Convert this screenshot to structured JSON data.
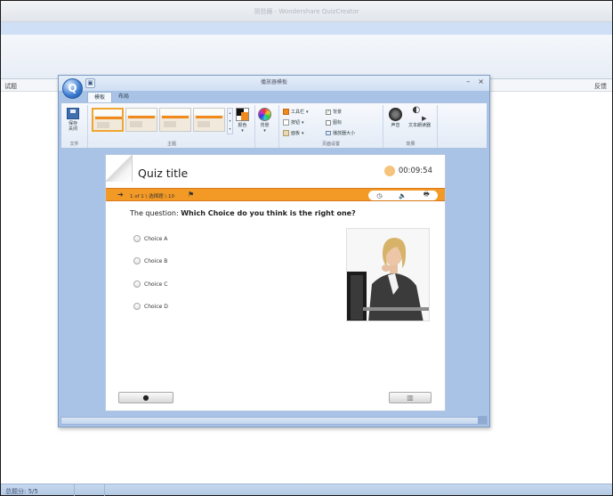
{
  "app": {
    "title": "测验器 - Wondershare QuizCreator",
    "left_panel_label": "试题",
    "right_panel_label": "反馈",
    "status_text": "总题分: 5/5"
  },
  "dialog": {
    "title": "播放器模板",
    "tabs": [
      {
        "label": "模板",
        "active": true
      },
      {
        "label": "布局",
        "active": false
      }
    ],
    "controls": {
      "minimize": "–",
      "close": "×"
    },
    "ribbon": {
      "save_group": {
        "button_label": "保存\n关闭",
        "caption": "文件"
      },
      "theme_group": {
        "caption": "主题",
        "thumbnails": 4,
        "selected_index": 0
      },
      "color_button": "颜色",
      "bg_button": "背景",
      "page_group": {
        "caption": "页面设置",
        "options": [
          {
            "label": "工具栏",
            "swatch": "#f08a1c"
          },
          {
            "label": "按钮",
            "swatch": "#ffffff"
          },
          {
            "label": "面板",
            "swatch": "#e9d9b3"
          }
        ],
        "checks": [
          {
            "label": "背景",
            "checked": true
          },
          {
            "label": "图标",
            "checked": false
          },
          {
            "label": "播放器大小",
            "checked": false
          }
        ]
      },
      "effect_group": {
        "caption": "效果",
        "sound_label": "声音",
        "tts_label": "文本朗读器"
      }
    }
  },
  "quiz": {
    "title": "Quiz title",
    "timer": "00:09:54",
    "progress": "1 of 1 \\ 选择题 \\ 10",
    "question_prefix": "The question:",
    "question_text": "Which Choice do you think is the right one?",
    "choices": [
      "Choice A",
      "Choice B",
      "Choice C",
      "Choice D"
    ],
    "tools": [
      "◷",
      "🔈",
      "🖶"
    ],
    "nav_next_glyph": "➔",
    "left_button_glyph": "●",
    "right_button_glyph": "▥",
    "orange_color": "#f39a26"
  }
}
